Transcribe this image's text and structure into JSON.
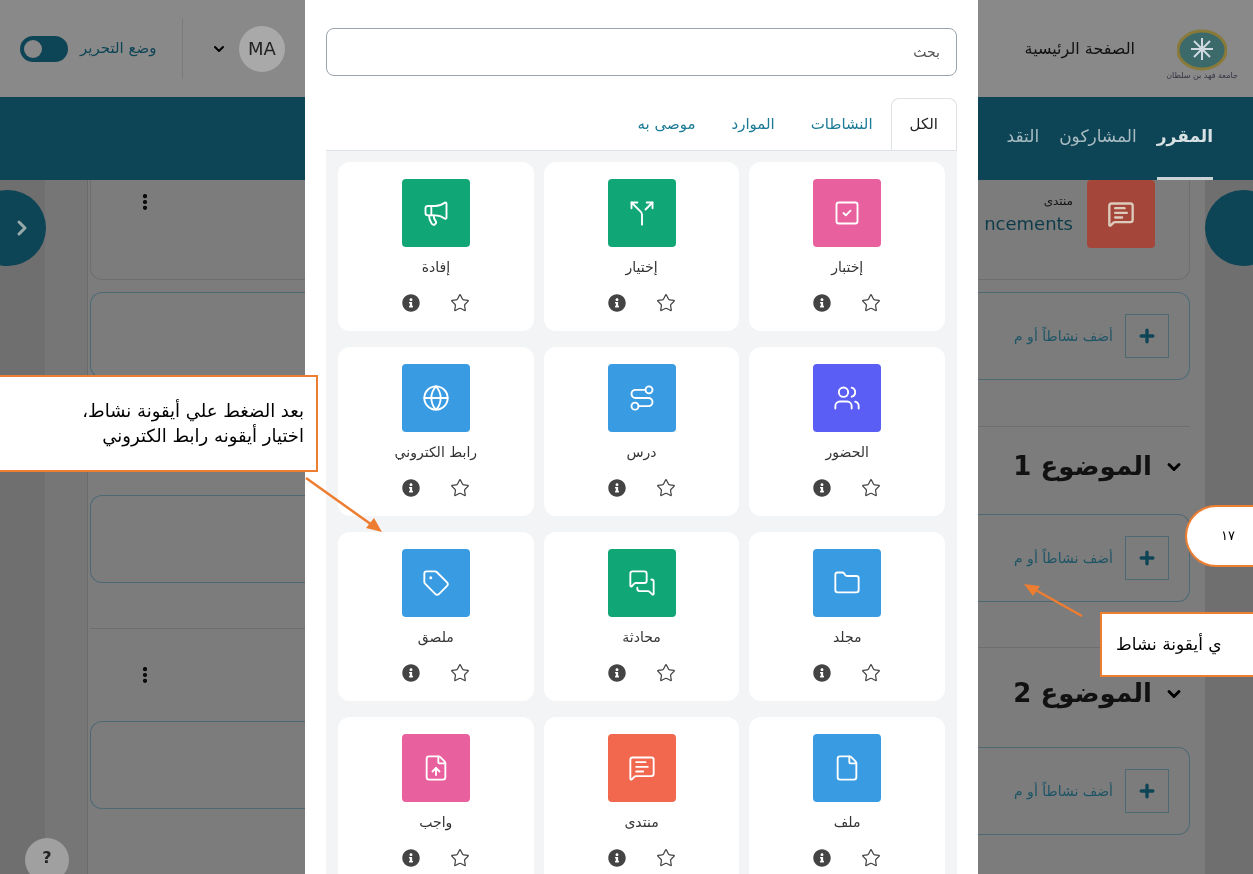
{
  "header_left": {
    "edit_mode": {
      "label": "وضع التحرير",
      "on": false
    },
    "avatar": "MA"
  },
  "header_right": {
    "home_link": "الصفحة الرئيسية",
    "logo_text": "جامعة فهد بن سلطان"
  },
  "course_nav": [
    {
      "label": "المقرر",
      "selected": true
    },
    {
      "label": "المشاركون",
      "selected": false
    },
    {
      "label": "التقد",
      "selected": false
    }
  ],
  "course_blocks": [
    {
      "kind": "forum",
      "type": "منتدى",
      "name": "ncements"
    },
    {
      "kind": "add",
      "label": "أضف نشاطاً أو م"
    },
    {
      "kind": "section",
      "title": "الموضوع 1"
    },
    {
      "kind": "add",
      "label": "أضف نشاطاً أو م"
    },
    {
      "kind": "section",
      "title": "الموضوع 2"
    },
    {
      "kind": "add",
      "label": "أضف نشاطاً أو م"
    }
  ],
  "help_button": "?",
  "modal": {
    "search": {
      "placeholder": "بحث"
    },
    "tabs": [
      {
        "label": "الكل",
        "selected": true
      },
      {
        "label": "النشاطات",
        "selected": false
      },
      {
        "label": "الموارد",
        "selected": false
      },
      {
        "label": "موصى به",
        "selected": false
      }
    ],
    "items": [
      {
        "kind": "quiz",
        "name": "إختبار",
        "color": "#e8609e"
      },
      {
        "kind": "choice",
        "name": "إختيار",
        "color": "#11a676"
      },
      {
        "kind": "feedback",
        "name": "إفادة",
        "color": "#11a676"
      },
      {
        "kind": "attendance",
        "name": "الحضور",
        "color": "#5b5ef5"
      },
      {
        "kind": "lesson",
        "name": "درس",
        "color": "#399be2"
      },
      {
        "kind": "url",
        "name": "رابط الكتروني",
        "color": "#399be2"
      },
      {
        "kind": "folder",
        "name": "مجلد",
        "color": "#399be2"
      },
      {
        "kind": "chat",
        "name": "محادثة",
        "color": "#11a676"
      },
      {
        "kind": "label",
        "name": "ملصق",
        "color": "#399be2"
      },
      {
        "kind": "file",
        "name": "ملف",
        "color": "#399be2"
      },
      {
        "kind": "forum",
        "name": "منتدى",
        "color": "#f1684f"
      },
      {
        "kind": "assignment",
        "name": "واجب",
        "color": "#e8609e"
      }
    ]
  },
  "annotations": {
    "left_callout": "بعد الضغط علي أيقونة نشاط،\nاختيار أيقونه رابط الكتروني",
    "right_callout": "ي أيقونة نشاط",
    "page_number": "١٧"
  }
}
